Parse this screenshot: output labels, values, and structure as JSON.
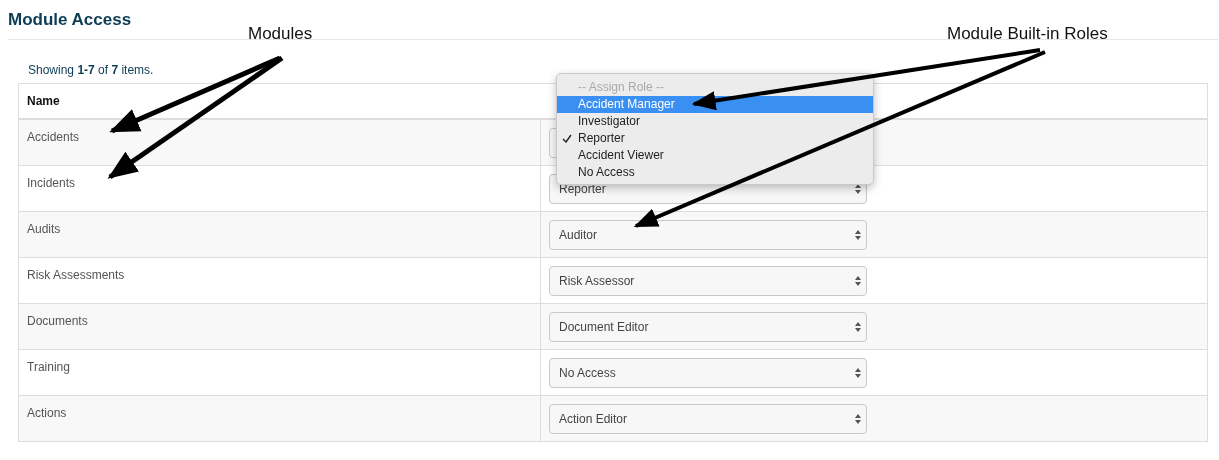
{
  "title": "Module Access",
  "annotations": [
    {
      "label": "Modules"
    },
    {
      "label": "Module Built-in Roles"
    }
  ],
  "summary": "Showing **1-7** of **7** items.",
  "table": {
    "columns": [
      "Name"
    ],
    "rows": [
      {
        "name": "Accidents"
      },
      {
        "name": "Incidents",
        "role": "Reporter"
      },
      {
        "name": "Audits",
        "role": "Auditor"
      },
      {
        "name": "Risk Assessments",
        "role": "Risk Assessor"
      },
      {
        "name": "Documents",
        "role": "Document Editor"
      },
      {
        "name": "Training",
        "role": "No Access"
      },
      {
        "name": "Actions",
        "role": "Action Editor"
      }
    ]
  },
  "role_menu": [
    {
      "label": "-- Assign Role --",
      "disabled": true,
      "selected": false,
      "checked": false
    },
    {
      "label": "Accident Manager",
      "disabled": false,
      "selected": true,
      "checked": false
    },
    {
      "label": "Investigator",
      "disabled": false,
      "selected": false,
      "checked": false
    },
    {
      "label": "Reporter",
      "disabled": false,
      "selected": false,
      "checked": true
    },
    {
      "label": "Accident Viewer",
      "disabled": false,
      "selected": false,
      "checked": false
    },
    {
      "label": "No Access",
      "disabled": false,
      "selected": false,
      "checked": false
    }
  ]
}
